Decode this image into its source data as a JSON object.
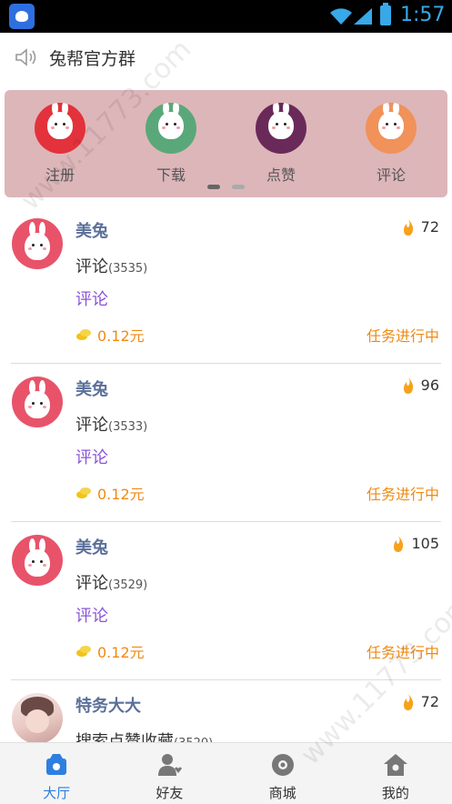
{
  "status_bar": {
    "time": "1:57"
  },
  "announcement": {
    "text": "兔帮官方群",
    "icon": "speaker-icon"
  },
  "banner": {
    "background": "#ddb6b9",
    "actions": [
      {
        "label": "注册",
        "color": "#e3323c"
      },
      {
        "label": "下载",
        "color": "#5aa87a"
      },
      {
        "label": "点赞",
        "color": "#6a2a59"
      },
      {
        "label": "评论",
        "color": "#f0925a"
      }
    ]
  },
  "feed": [
    {
      "user": "美兔",
      "heat": "72",
      "task": "评论",
      "count": "(3535)",
      "link": "评论",
      "reward": "0.12元",
      "status": "任务进行中",
      "avatar": "bunny"
    },
    {
      "user": "美兔",
      "heat": "96",
      "task": "评论",
      "count": "(3533)",
      "link": "评论",
      "reward": "0.12元",
      "status": "任务进行中",
      "avatar": "bunny"
    },
    {
      "user": "美兔",
      "heat": "105",
      "task": "评论",
      "count": "(3529)",
      "link": "评论",
      "reward": "0.12元",
      "status": "任务进行中",
      "avatar": "bunny"
    },
    {
      "user": "特务大大",
      "heat": "72",
      "task": "搜索点赞收藏",
      "count": "(3520)",
      "link": "",
      "reward": "",
      "status": "",
      "avatar": "photo"
    }
  ],
  "bottom_nav": [
    {
      "label": "大厅",
      "icon": "hall-icon",
      "active": true
    },
    {
      "label": "好友",
      "icon": "friend-icon",
      "active": false
    },
    {
      "label": "商城",
      "icon": "shop-icon",
      "active": false
    },
    {
      "label": "我的",
      "icon": "home-icon",
      "active": false
    }
  ],
  "watermark": "www.11773.com",
  "colors": {
    "accent": "#2f7fe0",
    "orange": "#f08a12",
    "username": "#5a6f9a",
    "link": "#8a55d8"
  }
}
